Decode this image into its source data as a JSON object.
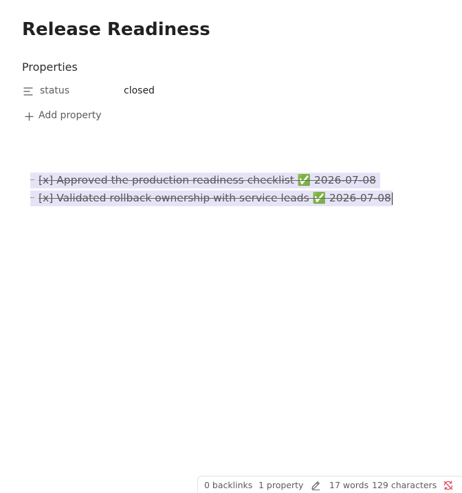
{
  "note": {
    "title": "Release Readiness"
  },
  "properties": {
    "heading": "Properties",
    "items": [
      {
        "icon": "text-lines-icon",
        "key": "status",
        "value": "closed"
      }
    ],
    "add_label": "Add property"
  },
  "editor": {
    "lines": [
      "[x] Approved the production readiness checklist ✅ 2026-07-08",
      "[x] Validated rollback ownership with service leads ✅ 2026-07-08"
    ],
    "selection_color": "#e7e3f7"
  },
  "status_bar": {
    "backlinks": "0 backlinks",
    "properties": "1 property",
    "words": "17 words",
    "characters": "129 characters",
    "sync_status_color": "#e0475b"
  }
}
